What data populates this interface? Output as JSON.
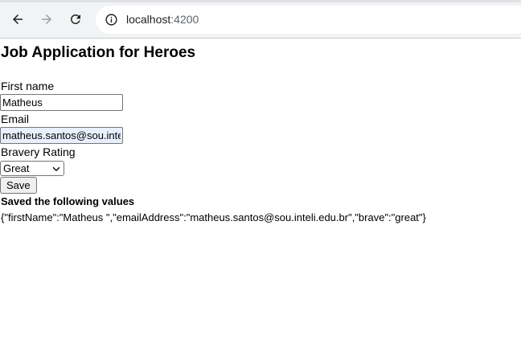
{
  "browser": {
    "url_host": "localhost",
    "url_port": ":4200"
  },
  "form": {
    "title": "Job Application for Heroes",
    "first_name": {
      "label": "First name",
      "value": "Matheus"
    },
    "email": {
      "label": "Email",
      "value": "matheus.santos@sou.inteli.edu.br"
    },
    "bravery": {
      "label": "Bravery Rating",
      "selected": "Great"
    },
    "save_label": "Save"
  },
  "result": {
    "heading": "Saved the following values",
    "json_text": "{\"firstName\":\"Matheus \",\"emailAddress\":\"matheus.santos@sou.inteli.edu.br\",\"brave\":\"great\"}"
  }
}
